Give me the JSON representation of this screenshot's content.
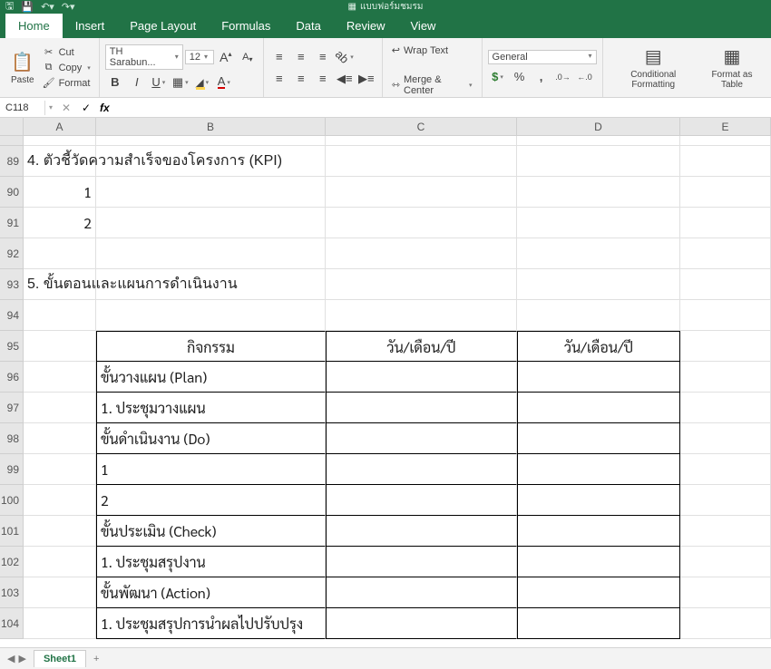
{
  "app": {
    "doc_title": "แบบฟอร์มชมรม",
    "tabs": [
      "Home",
      "Insert",
      "Page Layout",
      "Formulas",
      "Data",
      "Review",
      "View"
    ],
    "active_tab": 0
  },
  "clipboard": {
    "paste": "Paste",
    "cut": "Cut",
    "copy": "Copy",
    "format": "Format"
  },
  "font": {
    "name": "TH Sarabun...",
    "size": "12",
    "incA": "A",
    "decA": "A",
    "bold": "B",
    "italic": "I",
    "underline": "U",
    "fontcolor": "A"
  },
  "align": {
    "wrap": "Wrap Text",
    "merge": "Merge & Center"
  },
  "number": {
    "format": "General",
    "currency": "$",
    "percent": "%",
    "comma": ",",
    "dec_inc": ".0",
    "dec_dec": ".00"
  },
  "styles": {
    "cond": "Conditional Formatting",
    "ftable": "Format as Table"
  },
  "fbar": {
    "namebox": "C118",
    "fx": "fx",
    "value": ""
  },
  "columns": [
    "A",
    "B",
    "C",
    "D",
    "E"
  ],
  "rows": [
    {
      "n": ""
    },
    {
      "n": "89",
      "a": "",
      "b": "4. ตัวชี้วัดความสำเร็จของโครงการ (KPI)",
      "span": true
    },
    {
      "n": "90",
      "a": "1"
    },
    {
      "n": "91",
      "a": "2"
    },
    {
      "n": "92"
    },
    {
      "n": "93",
      "b": "5. ขั้นตอนและแผนการดำเนินงาน",
      "span": true
    },
    {
      "n": "94"
    },
    {
      "n": "95",
      "b": "กิจกรรม",
      "c": "วัน/เดือน/ปี",
      "d": "วัน/เดือน/ปี",
      "hdr": true
    },
    {
      "n": "96",
      "b": "ขั้นวางแผน (Plan)"
    },
    {
      "n": "97",
      "b": "1. ประชุมวางแผน"
    },
    {
      "n": "98",
      "b": "ขั้นดำเนินงาน (Do)"
    },
    {
      "n": "99",
      "b": "1"
    },
    {
      "n": "100",
      "b": "2"
    },
    {
      "n": "101",
      "b": "ขั้นประเมิน (Check)"
    },
    {
      "n": "102",
      "b": "1. ประชุมสรุปงาน"
    },
    {
      "n": "103",
      "b": "ขั้นพัฒนา (Action)"
    },
    {
      "n": "104",
      "b": "1. ประชุมสรุปการนำผลไปปรับปรุง"
    }
  ],
  "sheet_tab": "Sheet1"
}
